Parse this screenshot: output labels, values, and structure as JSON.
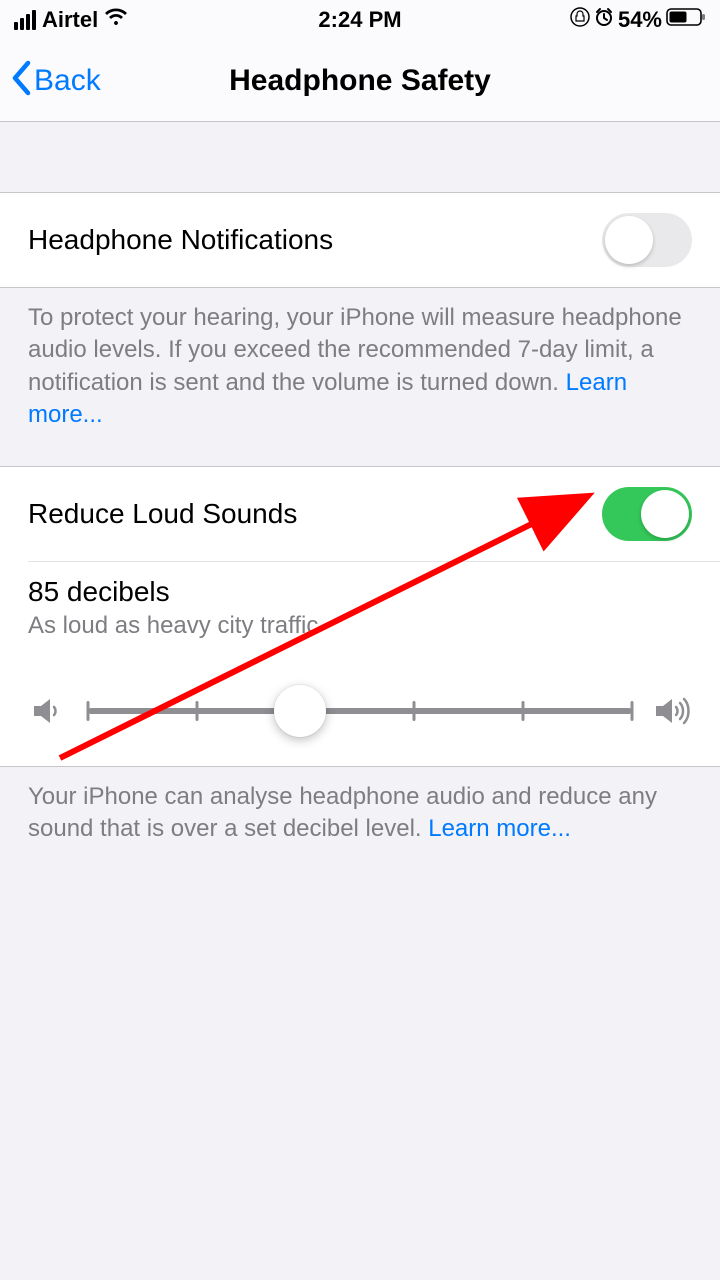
{
  "status": {
    "carrier": "Airtel",
    "time": "2:24 PM",
    "battery": "54%"
  },
  "nav": {
    "back_label": "Back",
    "title": "Headphone Safety"
  },
  "section1": {
    "row_label": "Headphone Notifications",
    "toggle_on": false,
    "footer_text": "To protect your hearing, your iPhone will measure headphone audio levels. If you exceed the recommended 7-day limit, a notification is sent and the volume is turned down. ",
    "learn_more": "Learn more..."
  },
  "section2": {
    "row_label": "Reduce Loud Sounds",
    "toggle_on": true,
    "decibel_value": "85 decibels",
    "decibel_caption": "As loud as heavy city traffic",
    "slider_percent": 39,
    "footer_text": "Your iPhone can analyse headphone audio and reduce any sound that is over a set decibel level. ",
    "learn_more": "Learn more..."
  },
  "colors": {
    "accent": "#007aff",
    "switch_on": "#34c759",
    "arrow": "#ff0000"
  }
}
